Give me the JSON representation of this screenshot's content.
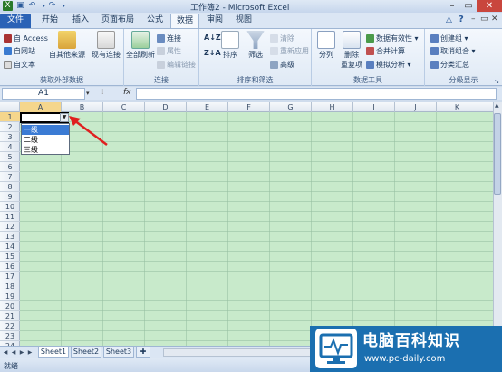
{
  "window": {
    "title": "工作簿2 - Microsoft Excel"
  },
  "tabs": [
    "文件",
    "开始",
    "插入",
    "页面布局",
    "公式",
    "数据",
    "审阅",
    "视图"
  ],
  "ribbon": {
    "external": {
      "access": "自 Access",
      "web": "自网站",
      "text": "自文本",
      "other": "自其他来源",
      "existing": "现有连接",
      "label": "获取外部数据"
    },
    "connections": {
      "refresh_all": "全部刷新",
      "connections": "连接",
      "properties": "属性",
      "edit_links": "编辑链接",
      "label": "连接"
    },
    "sortfilter": {
      "sort": "排序",
      "filter": "筛选",
      "clear": "清除",
      "reapply": "重新应用",
      "advanced": "高级",
      "label": "排序和筛选"
    },
    "datatools": {
      "text_to_columns": "分列",
      "remove_duplicates_1": "删除",
      "remove_duplicates_2": "重复项",
      "validation": "数据有效性",
      "consolidate": "合并计算",
      "whatif": "模拟分析",
      "label": "数据工具"
    },
    "outline": {
      "group": "创建组",
      "ungroup": "取消组合",
      "subtotal": "分类汇总",
      "label": "分级显示"
    }
  },
  "formula_bar": {
    "name_box": "A1",
    "fx": "fx",
    "value": ""
  },
  "columns": [
    "A",
    "B",
    "C",
    "D",
    "E",
    "F",
    "G",
    "H",
    "I",
    "J",
    "K"
  ],
  "rows": [
    "1",
    "2",
    "3",
    "4",
    "5",
    "6",
    "7",
    "8",
    "9",
    "10",
    "11",
    "12",
    "13",
    "14",
    "15",
    "16",
    "17",
    "18",
    "19",
    "20",
    "21",
    "22",
    "23",
    "24"
  ],
  "dropdown": {
    "options": [
      "一级",
      "二级",
      "三级"
    ],
    "selected_index": 0
  },
  "sheets": [
    "Sheet1",
    "Sheet2",
    "Sheet3"
  ],
  "status": {
    "text": "就绪"
  },
  "watermark": {
    "title": "电脑百科知识",
    "url": "www.pc-daily.com"
  },
  "colors": {
    "grid_bg": "#c8eacb",
    "file_tab": "#2a62b6",
    "arrow": "#e02020",
    "watermark_bg": "#1b6fb0"
  }
}
